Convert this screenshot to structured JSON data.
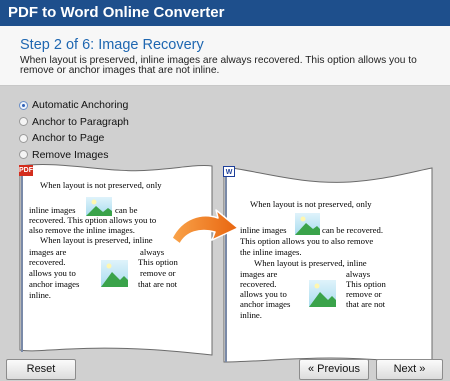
{
  "window": {
    "title": "PDF to Word Online Converter"
  },
  "step": {
    "title": "Step 2 of 6: Image Recovery",
    "description": "When layout is preserved, inline images are always recovered. This option allows you to remove or anchor images that are not inline."
  },
  "options": [
    {
      "label": "Automatic Anchoring",
      "selected": true
    },
    {
      "label": "Anchor to Paragraph",
      "selected": false
    },
    {
      "label": "Anchor to Page",
      "selected": false
    },
    {
      "label": "Remove Images",
      "selected": false
    }
  ],
  "preview": {
    "source_badge": "PDF",
    "target_badge": "W",
    "source_lines": {
      "l1": "When layout is not preserved, only",
      "l2a": "inline images",
      "l2b": "can be",
      "l3": "recovered. This option allows you to",
      "l4": "also remove the inline images.",
      "l5": "When layout is preserved, inline",
      "l6a": "images are",
      "l6b": "always",
      "l7a": "recovered.",
      "l7b": "This option",
      "l8a": "allows you to",
      "l8b": "remove or",
      "l9a": "anchor images",
      "l9b": "that are not",
      "l10": "inline."
    },
    "target_lines": {
      "l1": "When layout is not preserved, only",
      "l2a": "inline images",
      "l2b": "can be recovered.",
      "l3": "This option allows you to also remove",
      "l4": "the inline images.",
      "l5": "When layout is preserved, inline",
      "l6a": "images are",
      "l6b": "always",
      "l7a": "recovered.",
      "l7b": "This option",
      "l8a": "allows you to",
      "l8b": "remove or",
      "l9a": "anchor images",
      "l9b": "that are not",
      "l10": "inline."
    }
  },
  "buttons": {
    "reset": "Reset",
    "previous": "« Previous",
    "next": "Next »"
  },
  "colors": {
    "titlebar": "#1e4f8c",
    "step_title": "#1f67b1",
    "arrow": "#f07a1a",
    "pdf_badge": "#d32d1d",
    "word_badge": "#1d3f9a"
  }
}
